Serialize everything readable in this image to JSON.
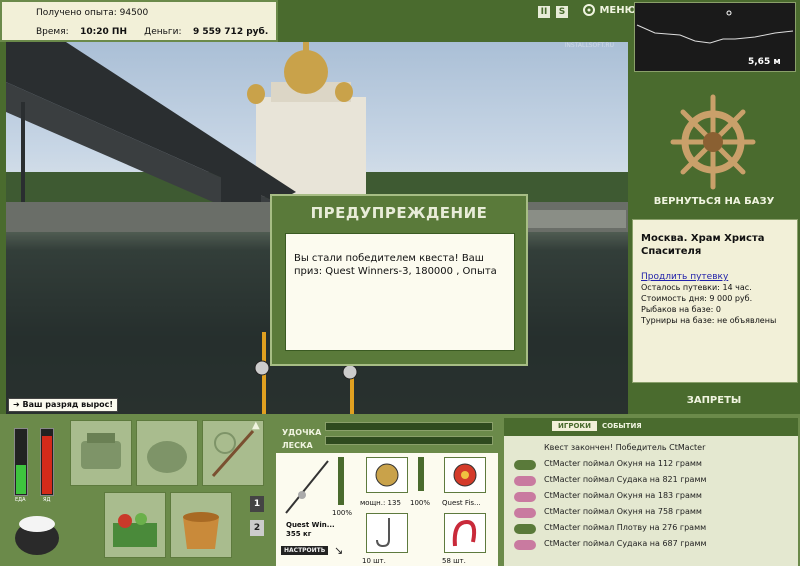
{
  "header": {
    "xp_label": "Получено опыта:",
    "xp_value": "94500",
    "time_label": "Время:",
    "time_value": "10:20 ПН",
    "money_label": "Деньги:",
    "money_value": "9 559 712 руб.",
    "pause_icon": "II",
    "sound_icon": "S",
    "menu_label": "МЕНЮ"
  },
  "depth": {
    "value": "5,65 м"
  },
  "scene": {
    "watermark": "INSTALLSOFT.RU"
  },
  "warning": {
    "title": "ПРЕДУПРЕЖДЕНИЕ",
    "message": "Вы стали победителем квеста! Ваш приз: Quest Winners-3, 180000 , Опыта"
  },
  "rank_badge": "Ваш разряд вырос!",
  "right": {
    "return_label": "ВЕРНУТЬСЯ НА БАЗУ",
    "location": "Москва. Храм Христа Спасителя",
    "extend_link": "Продлить путевку",
    "info": [
      "Осталось путевки: 14 час.",
      "Стоимость дня: 9 000 руб.",
      "Рыбаков на базе: 0",
      "Турниры на базе: не объявлены"
    ],
    "bans_label": "ЗАПРЕТЫ"
  },
  "meters": {
    "eat_label": "ЕДА",
    "poison_label": "ЯД",
    "eat_level": 0.45,
    "poison_level": 0.9
  },
  "pages": [
    "1",
    "2"
  ],
  "gear": {
    "rod_label": "УДОЧКА",
    "line_label": "ЛЕСКА",
    "rod_name": "Quest Win...",
    "rod_weight": "355 кг",
    "rod_pct": "100%",
    "reel_name": "мощн.: 135",
    "reel_pct": "100%",
    "bait_name": "Quest Fis...",
    "hook_count": "10 шт.",
    "worm_count": "58 шт.",
    "setup_label": "НАСТРОИТЬ"
  },
  "feed": {
    "tab_players": "ИГРОКИ",
    "tab_events": "СОБЫТИЯ",
    "lines": [
      {
        "text": "Квест закончен! Победитель CtMacter",
        "icon": "none"
      },
      {
        "text": "CtMacter поймал Окуня на 112 грамм",
        "icon": "perch"
      },
      {
        "text": "CtMacter поймал Судака на 821 грамм",
        "icon": "zander"
      },
      {
        "text": "CtMacter поймал Окуня на 183 грамм",
        "icon": "zander"
      },
      {
        "text": "CtMacter поймал Окуня на 758 грамм",
        "icon": "zander"
      },
      {
        "text": "CtMacter поймал Плотву на 276 грамм",
        "icon": "roach"
      },
      {
        "text": "CtMacter поймал Судака на 687 грамм",
        "icon": "zander"
      }
    ]
  },
  "colors": {
    "panel": "#4a6b2e",
    "accent": "#a7bd85",
    "paper": "#fcfbef"
  }
}
